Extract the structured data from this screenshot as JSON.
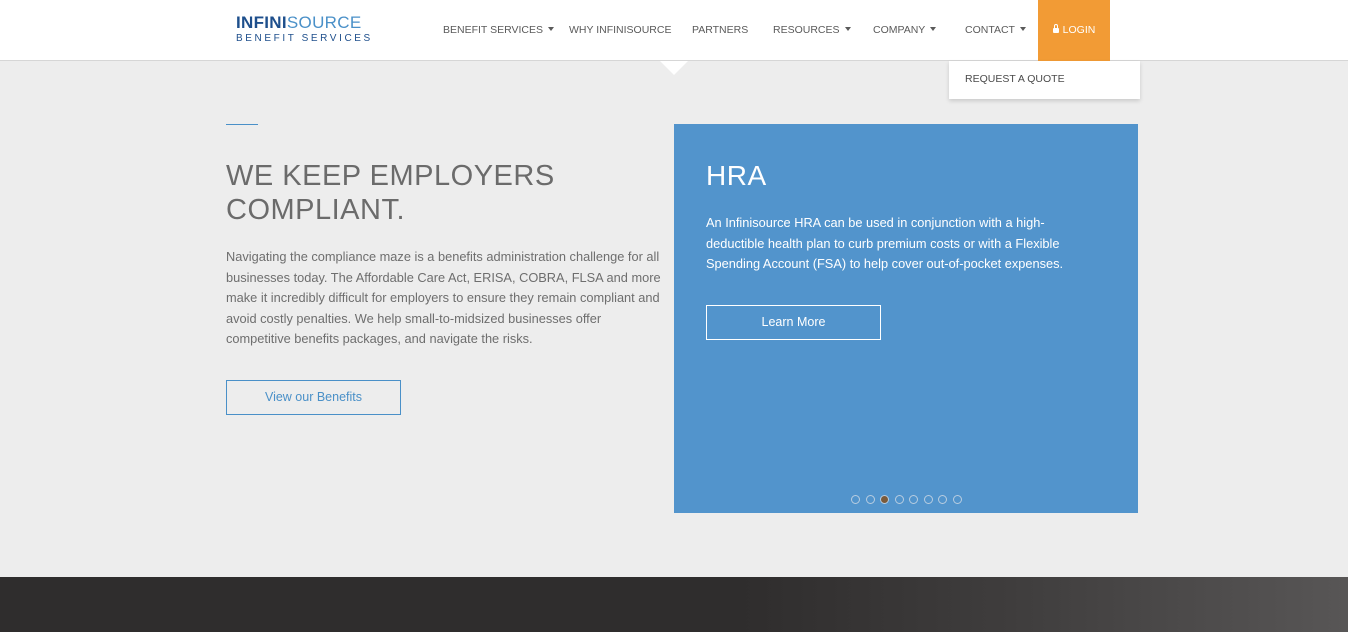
{
  "logo": {
    "line1_bold": "INFINI",
    "line1_rest": "SOURCE",
    "line2": "BENEFIT SERVICES"
  },
  "nav": {
    "items": [
      {
        "label": "BENEFIT SERVICES",
        "has_caret": true
      },
      {
        "label": "WHY INFINISOURCE",
        "has_caret": false
      },
      {
        "label": "PARTNERS",
        "has_caret": false
      },
      {
        "label": "RESOURCES",
        "has_caret": true
      },
      {
        "label": "COMPANY",
        "has_caret": true
      },
      {
        "label": "CONTACT",
        "has_caret": true
      }
    ],
    "login_label": "LOGIN",
    "dropdown_item": "REQUEST A QUOTE"
  },
  "hero": {
    "headline_line1": "WE KEEP EMPLOYERS",
    "headline_line2": "COMPLIANT.",
    "body": "Navigating the compliance maze is a benefits administration challenge for all businesses today. The Affordable Care Act, ERISA, COBRA, FLSA and more make it incredibly difficult for employers to ensure they remain compliant and avoid costly penalties. We help small-to-midsized businesses offer competitive benefits packages, and navigate the risks.",
    "button_label": "View our Benefits"
  },
  "slider": {
    "title": "HRA",
    "text": "An Infinisource HRA can be used in conjunction with a high-deductible health plan to curb premium costs or with a Flexible Spending Account (FSA) to help cover out-of-pocket expenses.",
    "button_label": "Learn More",
    "slide_count": 8,
    "active_index": 2
  },
  "colors": {
    "accent_blue": "#4a90c8",
    "card_blue": "#5294cc",
    "login_orange": "#f29b35",
    "footer_dark": "#2f2d2d"
  }
}
